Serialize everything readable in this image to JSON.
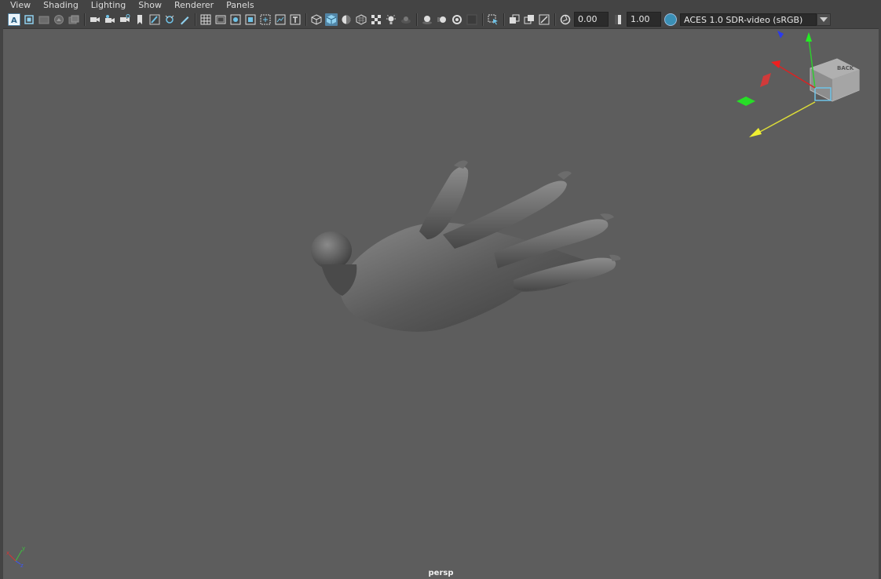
{
  "menubar": {
    "items": [
      "View",
      "Shading",
      "Lighting",
      "Show",
      "Renderer",
      "Panels"
    ]
  },
  "toolbar": {
    "exposure_value": "0.00",
    "gamma_value": "1.00",
    "color_space": "ACES 1.0 SDR-video (sRGB)",
    "accent_color": "#5285a6"
  },
  "viewcube": {
    "face_label": "BACK"
  },
  "viewport": {
    "camera_label": "persp",
    "background_color": "#5d5d5d"
  },
  "axis_indicator": {
    "x": "x",
    "y": "y",
    "z": "z"
  }
}
